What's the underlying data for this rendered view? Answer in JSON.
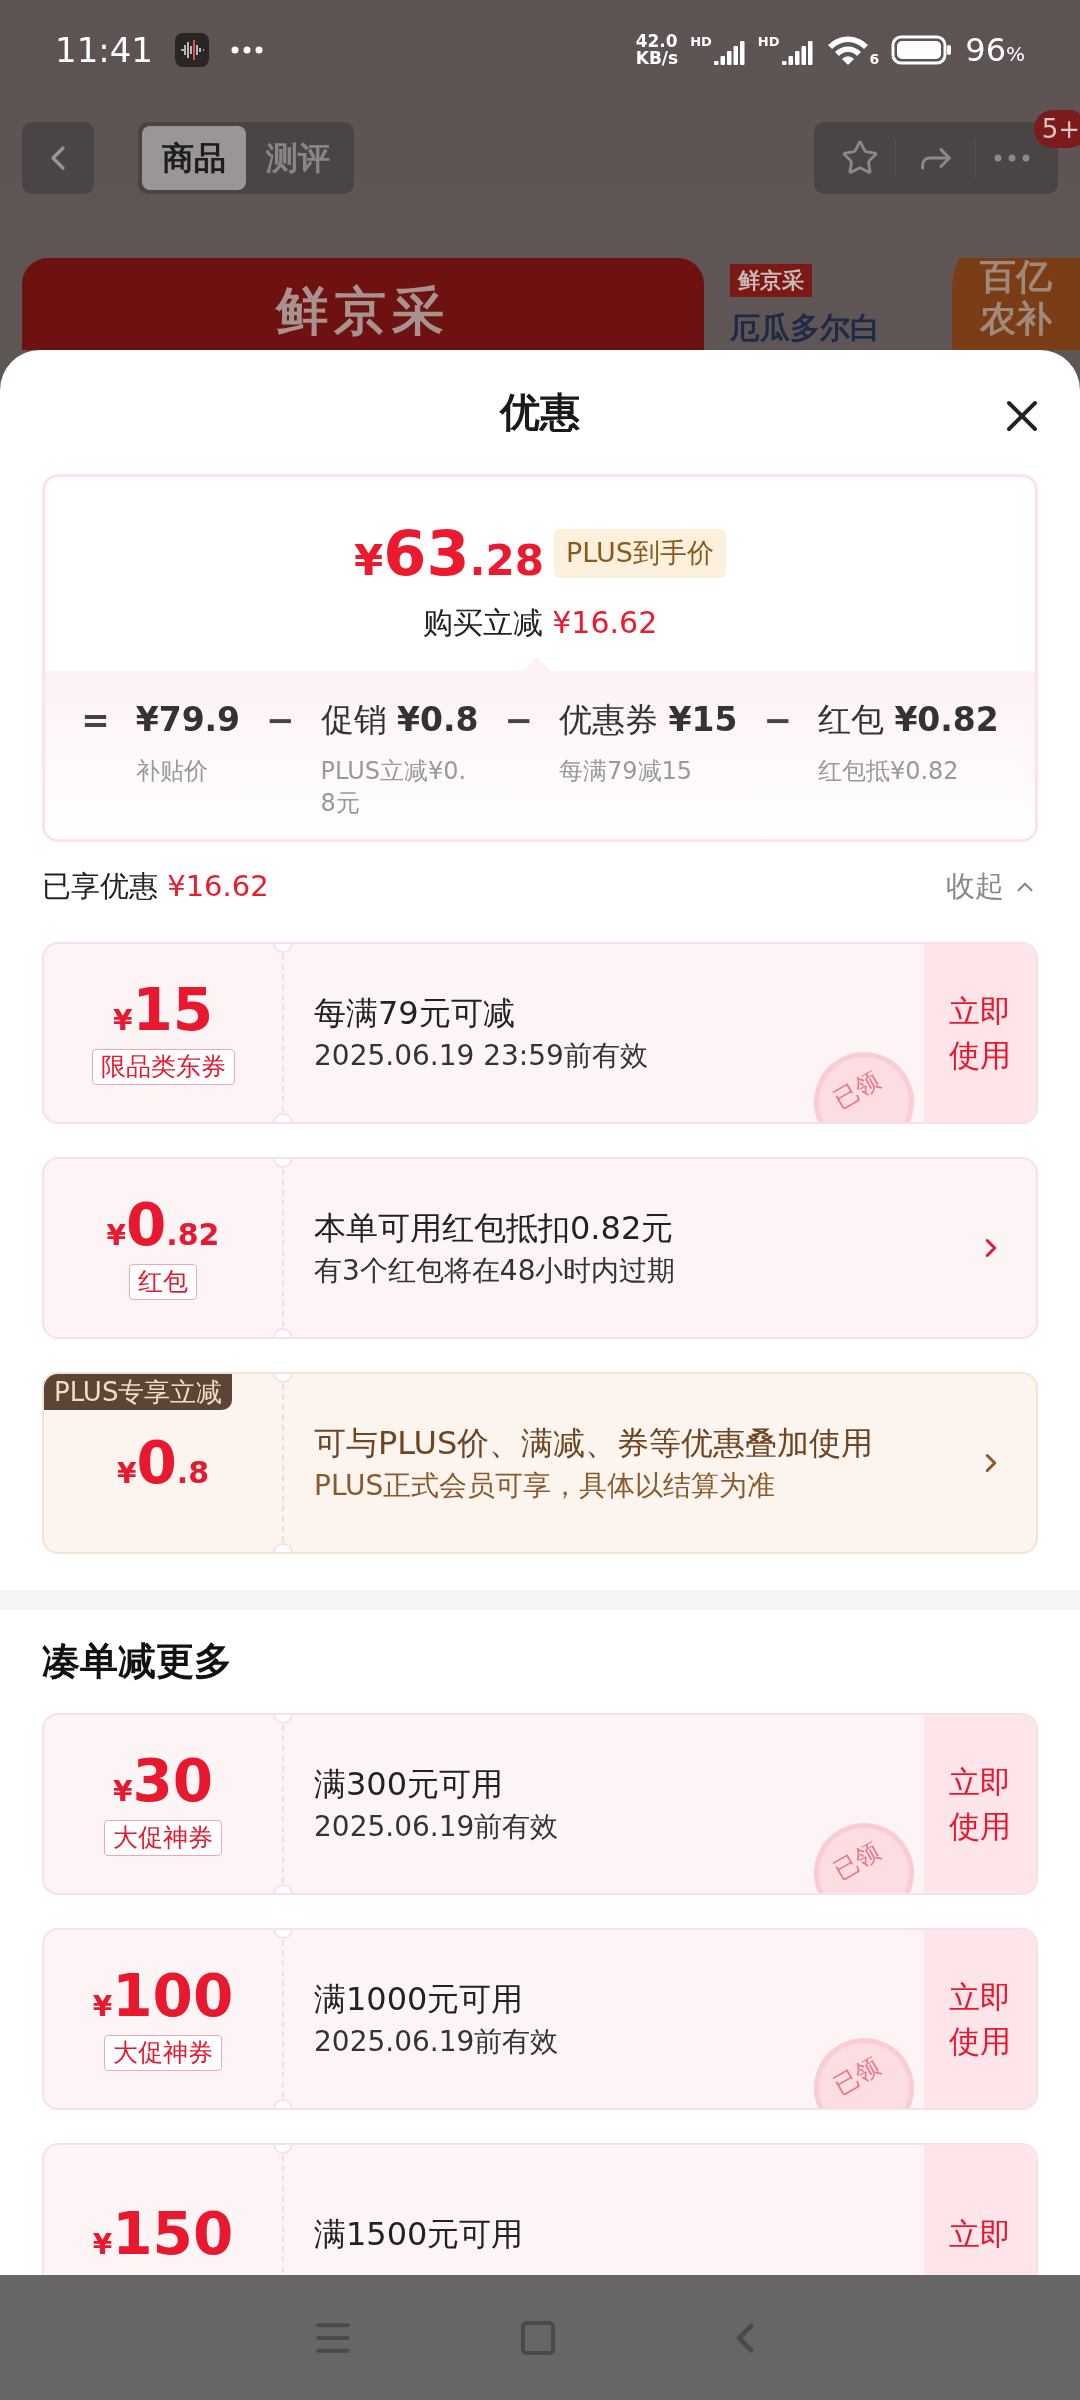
{
  "status_bar": {
    "time": "11:41",
    "net_speed": "42.0",
    "net_unit": "KB/s",
    "signal_labels": [
      "HD",
      "HD"
    ],
    "wifi_label": "6",
    "battery": "96",
    "battery_unit": "%"
  },
  "nav": {
    "tabs": [
      {
        "label": "商品",
        "selected": true
      },
      {
        "label": "测评",
        "selected": false
      }
    ],
    "badge": "5+"
  },
  "banner": {
    "title": "鲜京采",
    "brand": "鲜京采",
    "product": "厄瓜多尔白",
    "promo": [
      "百亿",
      "农补"
    ]
  },
  "sheet": {
    "title": "优惠"
  },
  "summary": {
    "currency": "¥",
    "price": "63",
    "price_decimal": ".28",
    "price_tag": "PLUS到手价",
    "saving_label": "购买立减",
    "saving": "¥16.62",
    "terms": [
      {
        "op": "=",
        "value": "¥79.9",
        "note": "补贴价"
      },
      {
        "op": "−",
        "label": "促销",
        "value": "¥0.8",
        "note": "PLUS立减¥0.8元"
      },
      {
        "op": "−",
        "label": "优惠券",
        "value": "¥15",
        "note": "每满79减15"
      },
      {
        "op": "−",
        "label": "红包",
        "value": "¥0.82",
        "note": "红包抵¥0.82"
      }
    ]
  },
  "applied": {
    "label": "已享优惠",
    "amount": "¥16.62",
    "toggle": "收起",
    "expanded": true
  },
  "coupons": [
    {
      "kind": "coupon",
      "currency": "¥",
      "amount": "15",
      "tag": "限品类东券",
      "title": "每满79元可减",
      "subtitle": "2025.06.19 23:59前有效",
      "action": "立即使用",
      "stamp": "已领"
    },
    {
      "kind": "redpacket",
      "currency": "¥",
      "amount": "0",
      "decimal": ".82",
      "tag": "红包",
      "title": "本单可用红包抵扣0.82元",
      "subtitle": "有3个红包将在48小时内过期"
    },
    {
      "kind": "plus",
      "ribbon": "PLUS专享立减",
      "currency": "¥",
      "amount": "0",
      "decimal": ".8",
      "title": "可与PLUS价、满减、券等优惠叠加使用",
      "subtitle": "PLUS正式会员可享，具体以结算为准"
    }
  ],
  "more": {
    "title": "凑单减更多",
    "coupons": [
      {
        "kind": "coupon",
        "currency": "¥",
        "amount": "30",
        "tag": "大促神券",
        "title": "满300元可用",
        "subtitle": "2025.06.19前有效",
        "action": "立即使用",
        "stamp": "已领"
      },
      {
        "kind": "coupon",
        "currency": "¥",
        "amount": "100",
        "tag": "大促神券",
        "title": "满1000元可用",
        "subtitle": "2025.06.19前有效",
        "action": "立即使用",
        "stamp": "已领"
      },
      {
        "kind": "coupon",
        "currency": "¥",
        "amount": "150",
        "title": "满1500元可用",
        "action": "立即"
      }
    ]
  }
}
